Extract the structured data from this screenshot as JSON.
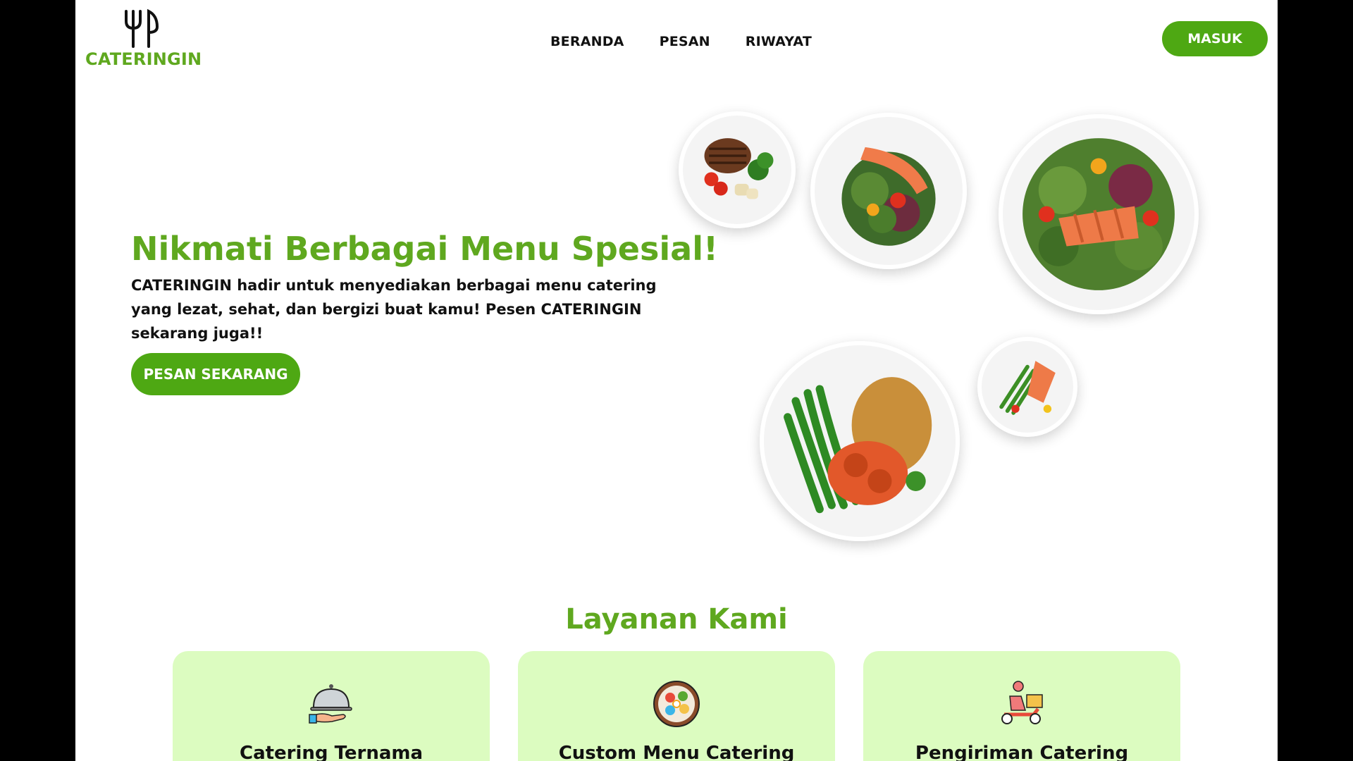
{
  "brand": {
    "name": "CATERINGIN",
    "logo_icon": "fork-knife-icon",
    "color": "#5fa81f"
  },
  "nav": {
    "items": [
      "BERANDA",
      "PESAN",
      "RIWAYAT"
    ]
  },
  "header": {
    "login_label": "MASUK"
  },
  "hero": {
    "title": "Nikmati Berbagai Menu Spesial!",
    "description": "CATERINGIN hadir untuk menyediakan berbagai menu catering yang  lezat, sehat, dan bergizi buat kamu! Pesen CATERINGIN sekarang juga!!",
    "cta_label": "PESAN SEKARANG",
    "images": [
      "steak-plate",
      "salmon-salad-plate",
      "salmon-salad-large-plate",
      "chicken-rice-beans-plate",
      "salmon-asparagus-plate"
    ]
  },
  "services": {
    "title": "Layanan Kami",
    "cards": [
      {
        "title": "Catering Ternama",
        "icon": "serving-cloche-icon"
      },
      {
        "title": "Custom Menu Catering",
        "icon": "food-bowl-icon"
      },
      {
        "title": "Pengiriman Catering",
        "icon": "delivery-scooter-icon"
      }
    ]
  },
  "colors": {
    "accent": "#4ea813",
    "card_bg": "#dcfcc0",
    "text": "#111111"
  }
}
